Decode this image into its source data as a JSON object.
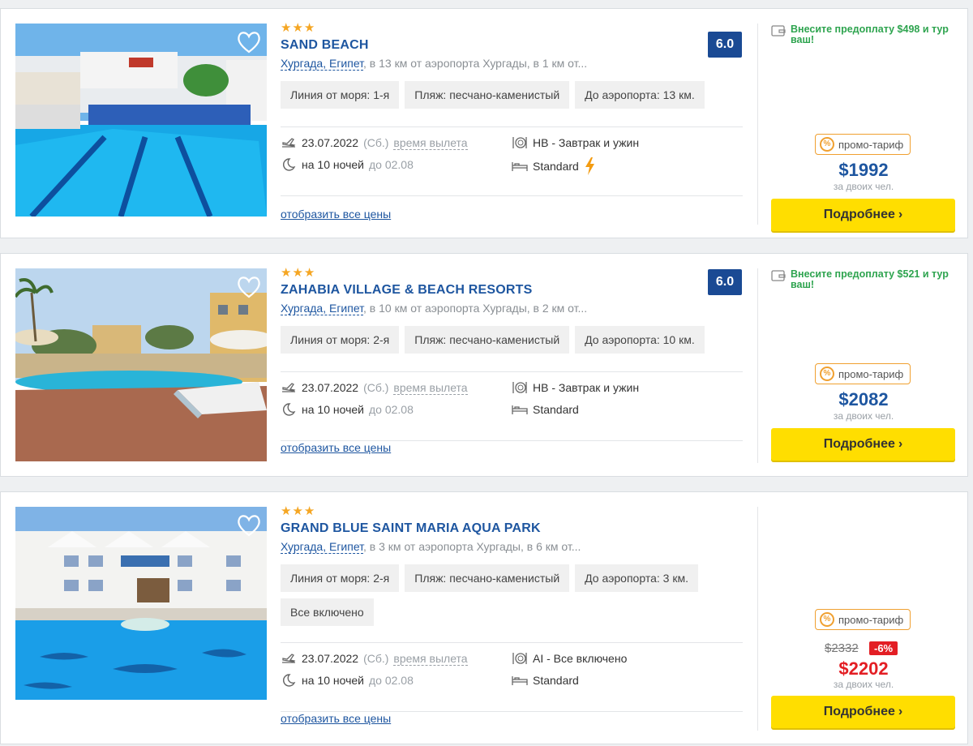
{
  "colors": {
    "brand_blue": "#1e56a0",
    "rating_bg": "#1a4a94",
    "prepay_green": "#2ea44f",
    "button_yellow": "#ffde00",
    "promo_orange": "#f0a030",
    "discount_red": "#e31e24",
    "star": "#f5a623"
  },
  "common": {
    "promo_label": "промо-тариф",
    "per_label": "за двоих чел.",
    "button_label": "Подробнее",
    "all_prices_label": "отобразить все цены",
    "departure_label": "время вылета",
    "nights_label": "на 10 ночей",
    "until_label": "до 02.08",
    "date": "23.07.2022",
    "weekday": "(Сб.)"
  },
  "hotels": [
    {
      "stars": "★★★",
      "name": "SAND BEACH",
      "location_link": "Хургада, Египет",
      "location_rest": ", в 13 км от аэропорта Хургады, в 1 км от...",
      "rating": "6.0",
      "tags": [
        "Линия от моря: 1-я",
        "Пляж: песчано-каменистый",
        "До аэропорта: 13 км."
      ],
      "meal": "HB - Завтрак и ужин",
      "room": "Standard",
      "prepay": "Внесите предоплату $498 и тур ваш!",
      "price": "$1992"
    },
    {
      "stars": "★★★",
      "name": "ZAHABIA VILLAGE & BEACH RESORTS",
      "location_link": "Хургада, Египет",
      "location_rest": ", в 10 км от аэропорта Хургады, в 2 км от...",
      "rating": "6.0",
      "tags": [
        "Линия от моря: 2-я",
        "Пляж: песчано-каменистый",
        "До аэропорта: 10 км."
      ],
      "meal": "HB - Завтрак и ужин",
      "room": "Standard",
      "prepay": "Внесите предоплату $521 и тур ваш!",
      "price": "$2082"
    },
    {
      "stars": "★★★",
      "name": "GRAND BLUE SAINT MARIA AQUA PARK",
      "location_link": "Хургада, Египет",
      "location_rest": ", в 3 км от аэропорта Хургады, в 6 км от...",
      "tags": [
        "Линия от моря: 2-я",
        "Пляж: песчано-каменистый",
        "До аэропорта: 3 км.",
        "Все включено"
      ],
      "meal": "AI - Все включено",
      "room": "Standard",
      "old_price": "$2332",
      "discount": "-6%",
      "price": "$2202"
    }
  ]
}
